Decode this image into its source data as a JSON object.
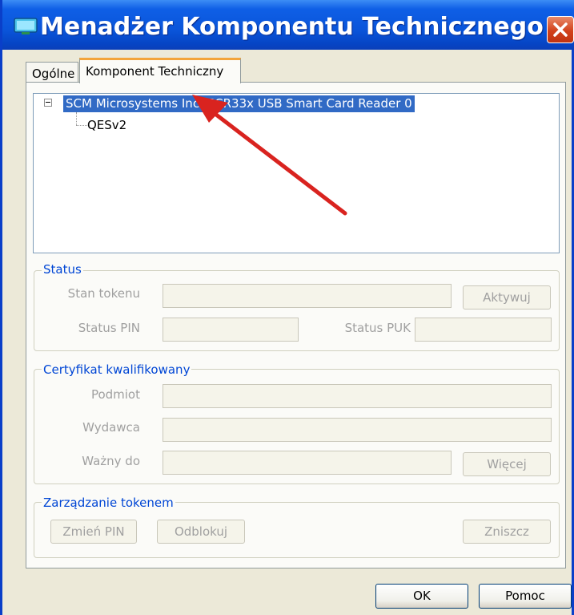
{
  "window": {
    "title": "Menadżer Komponentu Technicznego",
    "title_bar_color": "#0A55DA",
    "close_icon": "close-icon",
    "app_icon": "monitor-icon"
  },
  "tabs": [
    {
      "label": "Ogólne",
      "active": false
    },
    {
      "label": "Komponent Techniczny",
      "active": true
    }
  ],
  "tree": {
    "root": {
      "label": "SCM Microsystems Inc. SCR33x USB Smart Card Reader 0",
      "selected": true,
      "expanded": true
    },
    "children": [
      {
        "label": "QESv2"
      }
    ]
  },
  "status": {
    "legend": "Status",
    "token_state_label": "Stan tokenu",
    "activate_button": "Aktywuj",
    "pin_label": "Status PIN",
    "puk_label": "Status PUK"
  },
  "certificate": {
    "legend": "Certyfikat kwalifikowany",
    "subject_label": "Podmiot",
    "issuer_label": "Wydawca",
    "valid_to_label": "Ważny do",
    "more_button": "Więcej"
  },
  "token_management": {
    "legend": "Zarządzanie tokenem",
    "change_pin_button": "Zmień PIN",
    "unblock_button": "Odblokuj",
    "destroy_button": "Zniszcz"
  },
  "footer": {
    "ok_button": "OK",
    "help_button": "Pomoc"
  },
  "annotation": {
    "arrow_color": "#D9231F"
  }
}
